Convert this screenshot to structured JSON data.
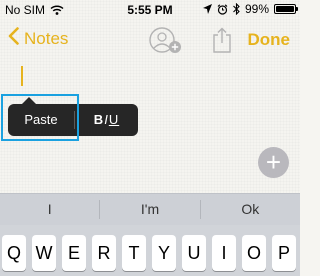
{
  "status_bar": {
    "carrier": "No SIM",
    "time": "5:55 PM",
    "battery_text": "99%",
    "battery_level": 0.99
  },
  "nav": {
    "back_label": "Notes",
    "done_label": "Done",
    "accent_color": "#e6b31e"
  },
  "edit_menu": {
    "paste_label": "Paste",
    "format_bold": "B",
    "format_italic": "I",
    "format_underline": "U",
    "highlight_color": "#1aa1e0"
  },
  "add_button_label": "+",
  "predictive": [
    "I",
    "I'm",
    "Ok"
  ],
  "keyboard_row": [
    "Q",
    "W",
    "E",
    "R",
    "T",
    "Y",
    "U",
    "I",
    "O",
    "P"
  ],
  "icons": {
    "wifi": "wifi-icon",
    "location": "location-arrow-icon",
    "alarm": "alarm-icon",
    "bluetooth": "bluetooth-icon",
    "share_people": "add-people-icon",
    "share": "share-icon"
  }
}
